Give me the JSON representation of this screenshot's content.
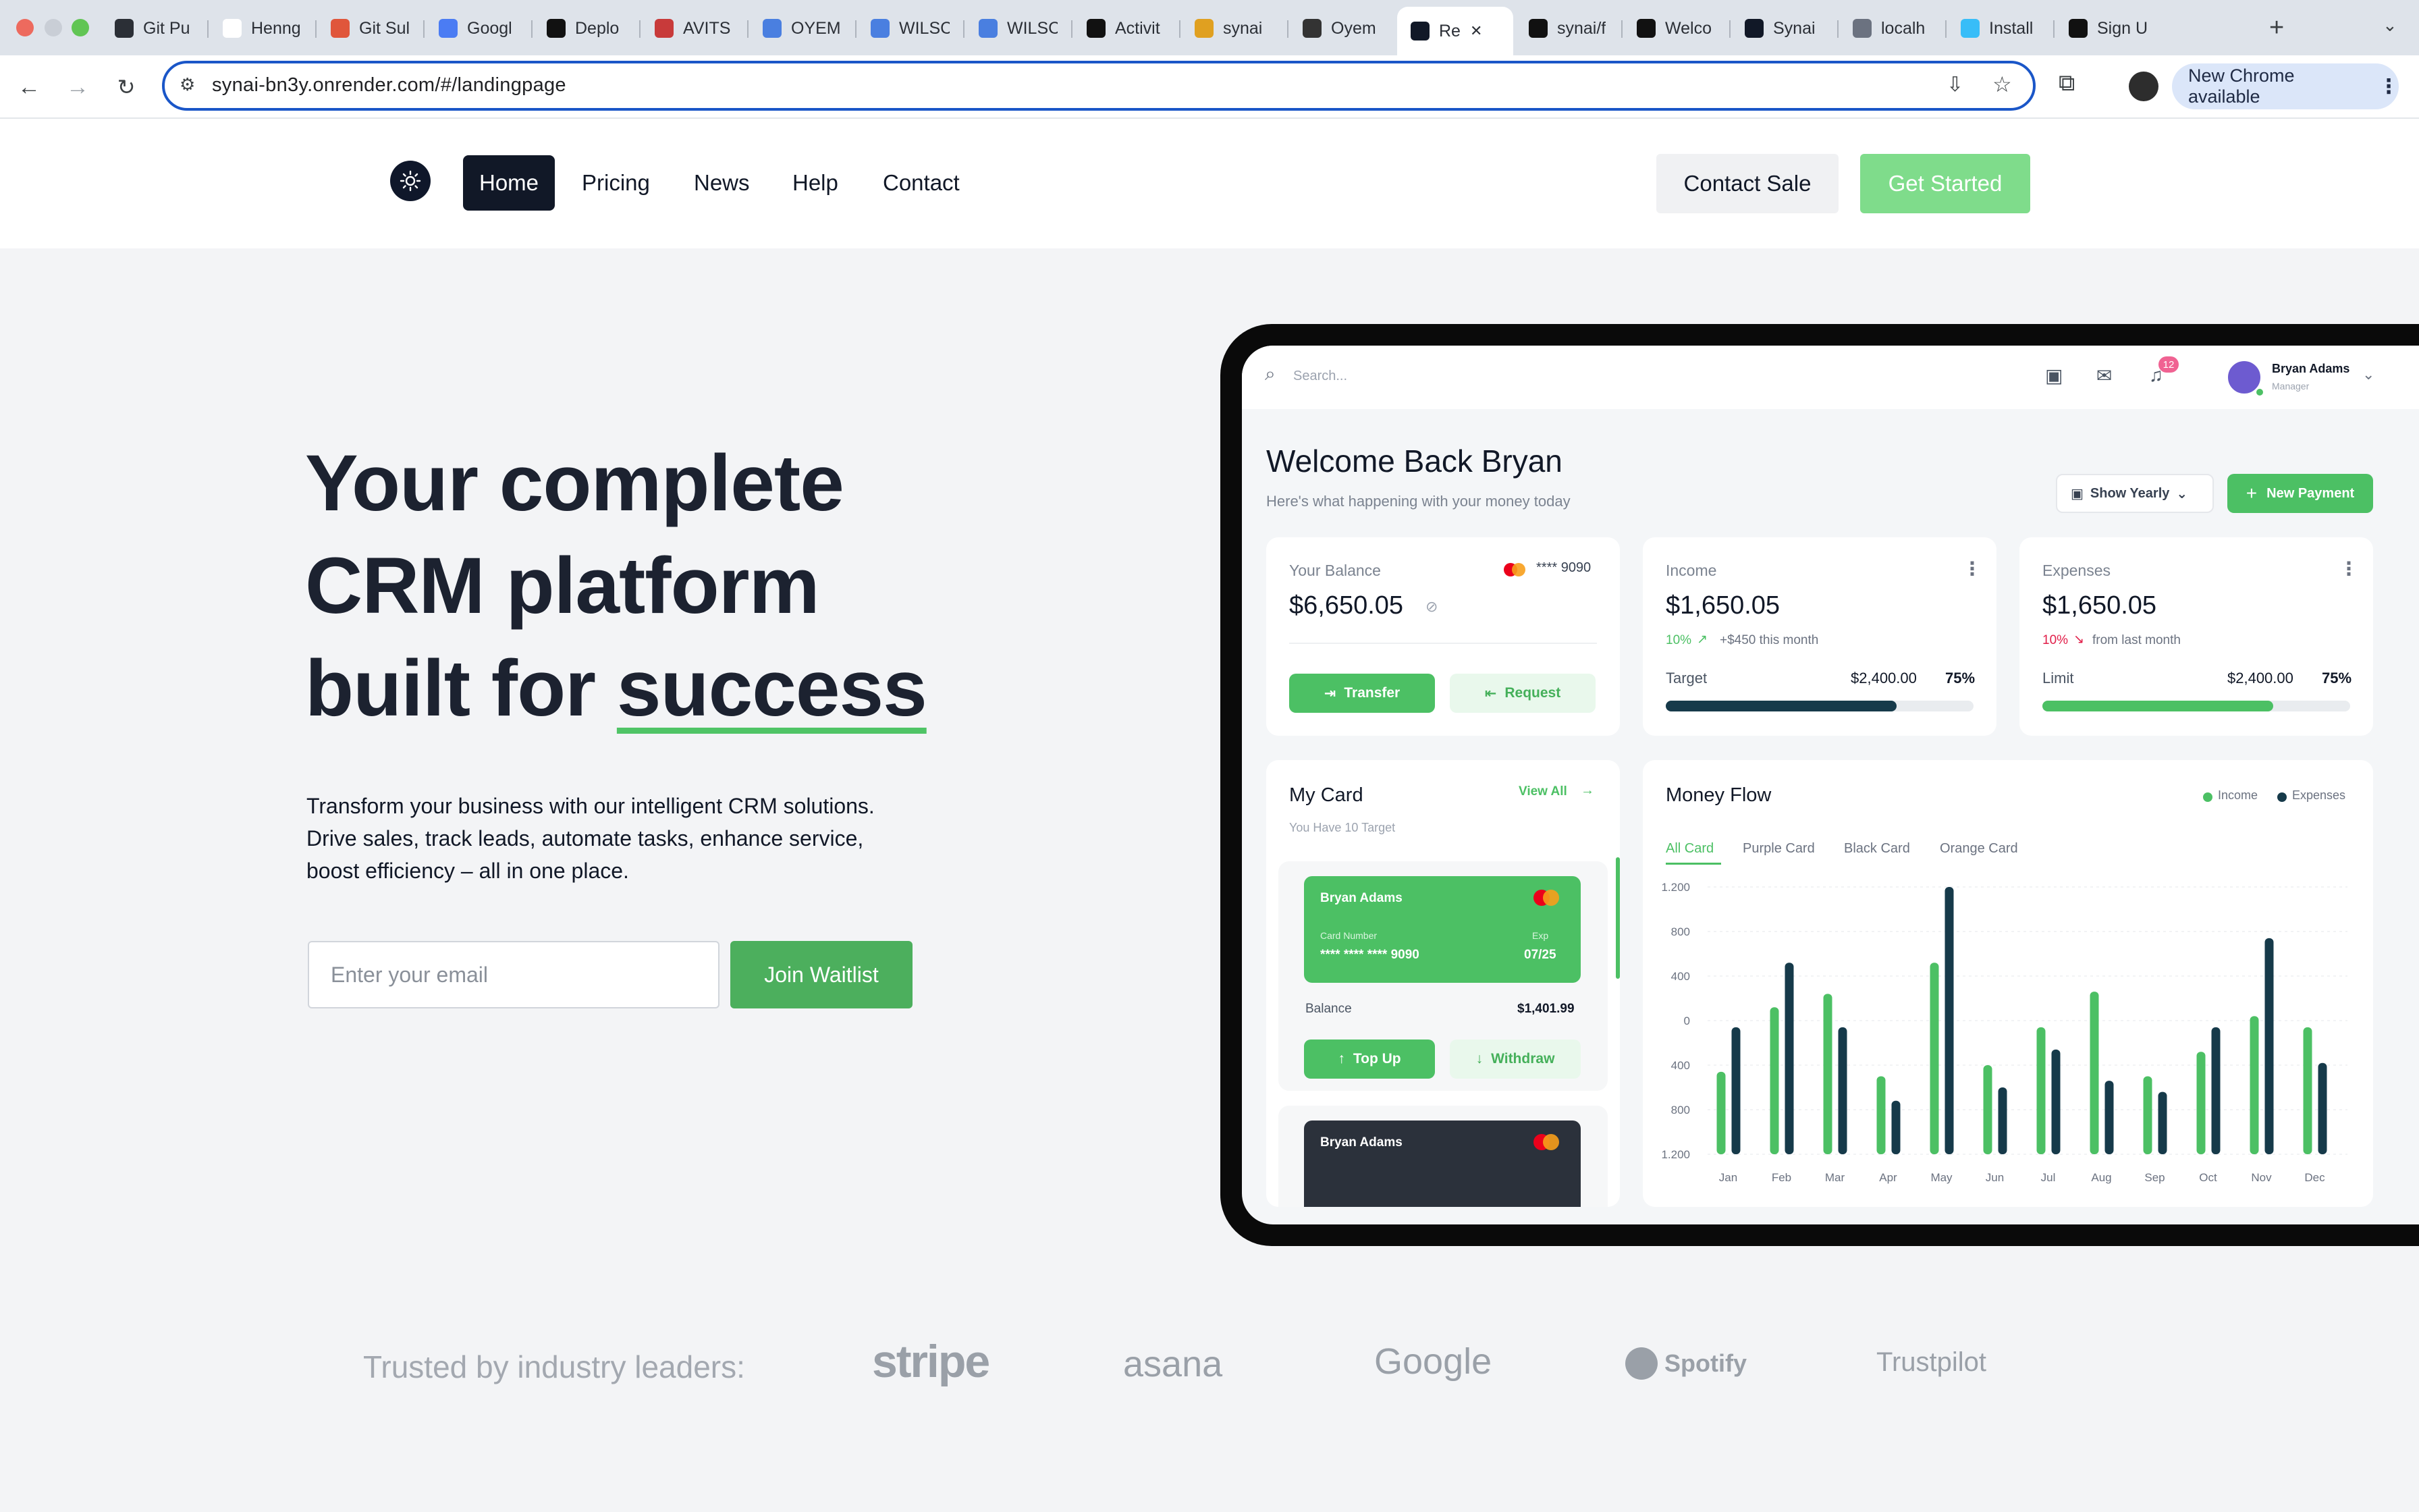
{
  "browser": {
    "tabs": [
      {
        "title": "Git Pu",
        "icon": "ring-icon",
        "color": "#2b2f36"
      },
      {
        "title": "Henng",
        "icon": "github-icon",
        "color": "#ffffff"
      },
      {
        "title": "Git Sul",
        "icon": "sunburst-icon",
        "color": "#e0563b"
      },
      {
        "title": "Googl",
        "icon": "sparkle-icon",
        "color": "#4b7cf3"
      },
      {
        "title": "Deplo",
        "icon": "render-icon",
        "color": "#111111"
      },
      {
        "title": "AVITS",
        "icon": "flag-icon",
        "color": "#c83a3a"
      },
      {
        "title": "OYEM",
        "icon": "doc-icon",
        "color": "#4a7fe0"
      },
      {
        "title": "WILSC",
        "icon": "doc-icon",
        "color": "#4a7fe0"
      },
      {
        "title": "WILSC",
        "icon": "doc-icon",
        "color": "#4a7fe0"
      },
      {
        "title": "Activit",
        "icon": "github-icon",
        "color": "#111111"
      },
      {
        "title": "synai",
        "icon": "bird-icon",
        "color": "#e0a020"
      },
      {
        "title": "Oyem",
        "icon": "avatar-icon",
        "color": "#333333"
      },
      {
        "title": "Re",
        "icon": "synai-icon",
        "color": "#111827",
        "active": true
      },
      {
        "title": "synai/f",
        "icon": "github-icon",
        "color": "#111111"
      },
      {
        "title": "Welco",
        "icon": "window-icon",
        "color": "#111111"
      },
      {
        "title": "Synai",
        "icon": "synai-icon",
        "color": "#111827"
      },
      {
        "title": "localh",
        "icon": "globe-icon",
        "color": "#6b7280"
      },
      {
        "title": "Install",
        "icon": "tailwind-icon",
        "color": "#38bdf8"
      },
      {
        "title": "Sign U",
        "icon": "triangle-icon",
        "color": "#111111"
      }
    ],
    "url": "synai-bn3y.onrender.com/#/landingpage",
    "update_label": "New Chrome available"
  },
  "site": {
    "nav": [
      "Home",
      "Pricing",
      "News",
      "Help",
      "Contact"
    ],
    "contact_label": "Contact Sale",
    "cta_label": "Get Started"
  },
  "hero": {
    "title_line1": "Your complete",
    "title_line2": "CRM platform",
    "title_line3_a": "built for ",
    "title_line3_b": "success",
    "subtitle_1": "Transform your business with our intelligent CRM solutions.",
    "subtitle_2": "Drive sales, track leads, automate tasks, enhance service,",
    "subtitle_3": "boost efficiency – all in one place.",
    "email_placeholder": "Enter your email",
    "join_label": "Join Waitlist"
  },
  "dashboard": {
    "search_placeholder": "Search...",
    "notification_count": "12",
    "user_name": "Bryan Adams",
    "user_role": "Manager",
    "welcome": "Welcome Back Bryan",
    "welcome_sub": "Here's what happening with your money today",
    "period_label": "Show Yearly",
    "new_payment_label": "New Payment",
    "balance": {
      "label": "Your Balance",
      "card_digits": "**** 9090",
      "amount": "$6,650.05",
      "transfer": "Transfer",
      "request": "Request"
    },
    "income": {
      "label": "Income",
      "amount": "$1,650.05",
      "pct": "10%",
      "delta": "+$450 this month",
      "target_label": "Target",
      "target_value": "$2,400.00",
      "target_pct": "75%",
      "fill": 0.75
    },
    "expenses": {
      "label": "Expenses",
      "amount": "$1,650.05",
      "pct": "10%",
      "delta": "from last month",
      "limit_label": "Limit",
      "limit_value": "$2,400.00",
      "limit_pct": "75%",
      "fill": 0.75
    },
    "mycard": {
      "title": "My Card",
      "view_all": "View All",
      "subtitle": "You Have 10 Target",
      "card_holder": "Bryan Adams",
      "card_number_label": "Card Number",
      "card_number": "**** **** **** 9090",
      "exp_label": "Exp",
      "exp": "07/25",
      "balance_label": "Balance",
      "balance": "$1,401.99",
      "top_up": "Top Up",
      "withdraw": "Withdraw",
      "card2_holder": "Bryan Adams"
    },
    "moneyflow": {
      "title": "Money Flow",
      "legend_income": "Income",
      "legend_expenses": "Expenses",
      "tabs": [
        "All Card",
        "Purple Card",
        "Black Card",
        "Orange Card"
      ]
    }
  },
  "chart_data": {
    "type": "bar",
    "categories": [
      "Jan",
      "Feb",
      "Mar",
      "Apr",
      "May",
      "Jun",
      "Jul",
      "Aug",
      "Sep",
      "Oct",
      "Nov",
      "Dec"
    ],
    "yticks": [
      "1.200",
      "800",
      "400",
      "0",
      "400",
      "800",
      "1.200"
    ],
    "ylim": [
      0,
      1200
    ],
    "series": [
      {
        "name": "Income",
        "color": "#4cc064",
        "values": [
          370,
          660,
          720,
          350,
          860,
          400,
          570,
          730,
          350,
          460,
          620,
          570
        ]
      },
      {
        "name": "Expenses",
        "color": "#163a4a",
        "values": [
          570,
          860,
          570,
          240,
          1200,
          300,
          470,
          330,
          280,
          570,
          970,
          410
        ]
      }
    ]
  },
  "trusted": {
    "label": "Trusted by industry leaders:",
    "logos": [
      "stripe",
      "asana",
      "Google",
      "Spotify",
      "Trustpilot"
    ]
  }
}
